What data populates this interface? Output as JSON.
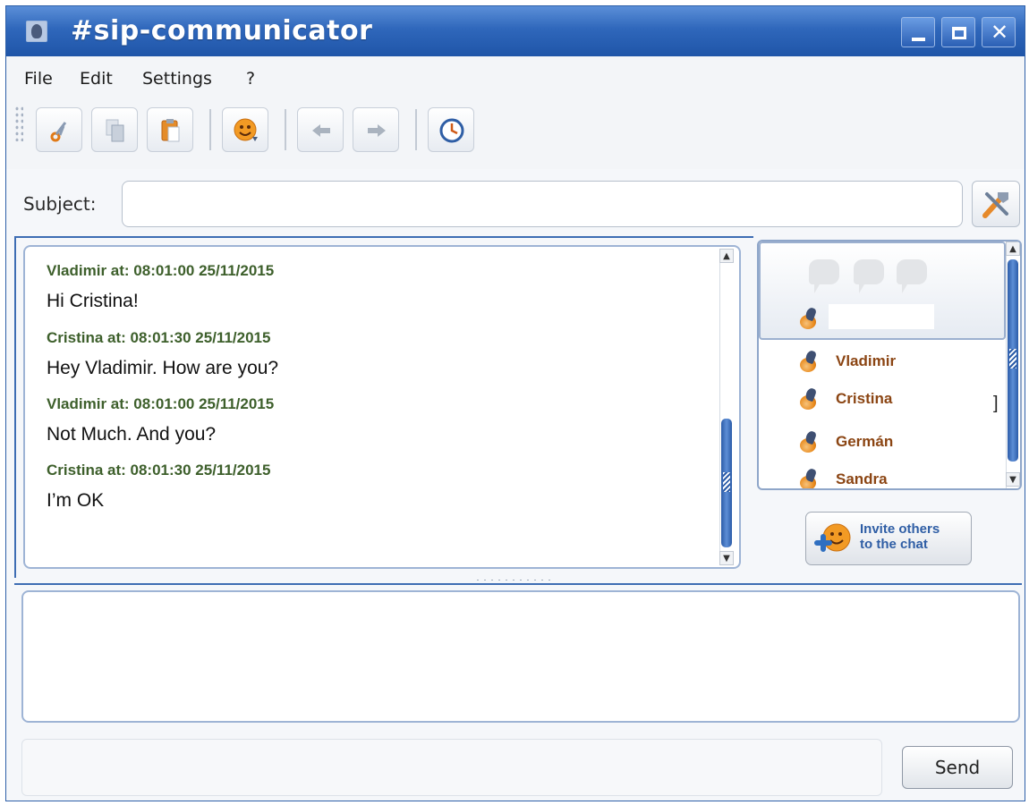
{
  "window": {
    "title": "#sip-communicator"
  },
  "menu": {
    "file": "File",
    "edit": "Edit",
    "settings": "Settings",
    "help": "?"
  },
  "toolbar": {
    "buttons": [
      "cut-icon",
      "copy-icon",
      "paste-icon",
      "smiley-icon",
      "back-arrow-icon",
      "forward-arrow-icon",
      "history-clock-icon"
    ]
  },
  "subject": {
    "label": "Subject:",
    "value": ""
  },
  "chat": {
    "messages": [
      {
        "header": "Vladimir at: 08:01:00 25/11/2015",
        "body": "Hi Cristina!"
      },
      {
        "header": "Cristina at: 08:01:30 25/11/2015",
        "body": "Hey Vladimir. How are you?"
      },
      {
        "header": "Vladimir at: 08:01:00 25/11/2015",
        "body": "Not Much. And you?"
      },
      {
        "header": "Cristina at: 08:01:30 25/11/2015",
        "body": "I’m OK"
      }
    ]
  },
  "participants": {
    "list": [
      "Vladimir",
      "Cristina",
      "Germán",
      "Sandra"
    ],
    "cristina_suffix": "]"
  },
  "invite": {
    "line1": "Invite others",
    "line2": "to the chat"
  },
  "send": {
    "label": "Send"
  },
  "colors": {
    "title_bar": "#2f67bb",
    "message_header": "#3d5f2b",
    "participant_name": "#8b4513",
    "invite_text": "#2f5ea5"
  }
}
